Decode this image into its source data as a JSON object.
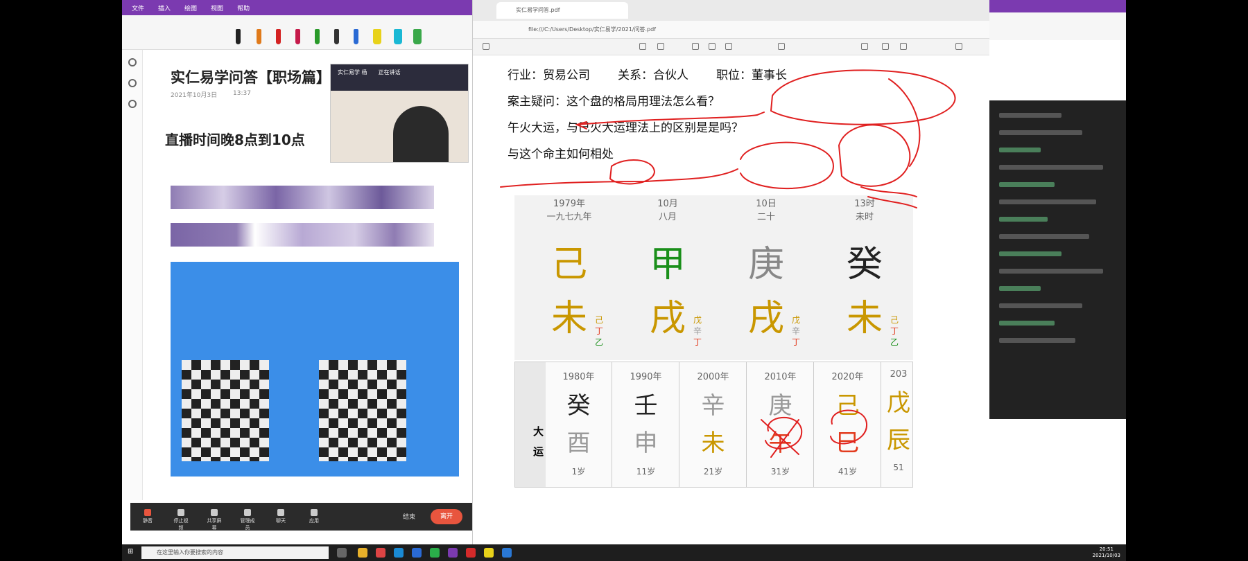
{
  "left": {
    "menu": [
      "文件",
      "插入",
      "绘图",
      "视图",
      "帮助"
    ],
    "page_title": "实仁易学问答【职场篇】",
    "page_date": "2021年10月3日",
    "page_time": "13:37",
    "live_time": "直播时间晚8点到10点",
    "video": {
      "name": "实仁易学 杨",
      "status": "正在讲话"
    },
    "meeting_buttons": [
      "静音",
      "停止视频",
      "共享屏幕",
      "管理成员",
      "聊天",
      "应用"
    ],
    "meeting_end": "结束",
    "leave": "离开"
  },
  "pdf": {
    "tab_title": "实仁易学问答.pdf",
    "address": "file:///C:/Users/Desktop/实仁易学/2021/问答.pdf",
    "line1": {
      "industry": "行业：贸易公司",
      "relation": "关系：合伙人",
      "position": "职位：董事长"
    },
    "line2": "案主疑问：这个盘的格局用理法怎么看？",
    "line3": "午火大运，与巳火大运理法上的区别是是吗？",
    "line4": "与这个命主如何相处",
    "pillars": [
      {
        "date": "1979年",
        "cn": "一九七九年",
        "stem": "己",
        "branch": "未",
        "stem_color": "#c99700",
        "branch_color": "#c99700",
        "hidden": [
          {
            "t": "己",
            "c": "#c99700"
          },
          {
            "t": "丁",
            "c": "#e23b1e"
          },
          {
            "t": "乙",
            "c": "#1a8f1a"
          }
        ]
      },
      {
        "date": "10月",
        "cn": "八月",
        "stem": "甲",
        "branch": "戌",
        "stem_color": "#1a8f1a",
        "branch_color": "#c99700",
        "hidden": [
          {
            "t": "戊",
            "c": "#c99700"
          },
          {
            "t": "辛",
            "c": "#999"
          },
          {
            "t": "丁",
            "c": "#e23b1e"
          }
        ]
      },
      {
        "date": "10日",
        "cn": "二十",
        "stem": "庚",
        "branch": "戌",
        "stem_color": "#888888",
        "branch_color": "#c99700",
        "hidden": [
          {
            "t": "戊",
            "c": "#c99700"
          },
          {
            "t": "辛",
            "c": "#999"
          },
          {
            "t": "丁",
            "c": "#e23b1e"
          }
        ]
      },
      {
        "date": "13时",
        "cn": "未时",
        "stem": "癸",
        "branch": "未",
        "stem_color": "#222222",
        "branch_color": "#c99700",
        "hidden": [
          {
            "t": "己",
            "c": "#c99700"
          },
          {
            "t": "丁",
            "c": "#e23b1e"
          },
          {
            "t": "乙",
            "c": "#1a8f1a"
          }
        ]
      }
    ],
    "dayun_label": "大运",
    "dayun": [
      {
        "year": "1980年",
        "stem": "癸",
        "branch": "酉",
        "age": "1岁",
        "sc": "#222",
        "bc": "#999"
      },
      {
        "year": "1990年",
        "stem": "壬",
        "branch": "申",
        "age": "11岁",
        "sc": "#222",
        "bc": "#999"
      },
      {
        "year": "2000年",
        "stem": "辛",
        "branch": "未",
        "age": "21岁",
        "sc": "#999",
        "bc": "#c99700"
      },
      {
        "year": "2010年",
        "stem": "庚",
        "branch": "午",
        "age": "31岁",
        "sc": "#999",
        "bc": "#e23b1e"
      },
      {
        "year": "2020年",
        "stem": "己",
        "branch": "巳",
        "age": "41岁",
        "sc": "#c99700",
        "bc": "#e23b1e"
      },
      {
        "year": "203",
        "stem": "戊",
        "branch": "辰",
        "age": "51",
        "sc": "#c99700",
        "bc": "#c99700"
      }
    ]
  },
  "taskbar": {
    "search_placeholder": "在这里输入你要搜索的内容",
    "time": "20:51",
    "date": "2021/10/03"
  }
}
